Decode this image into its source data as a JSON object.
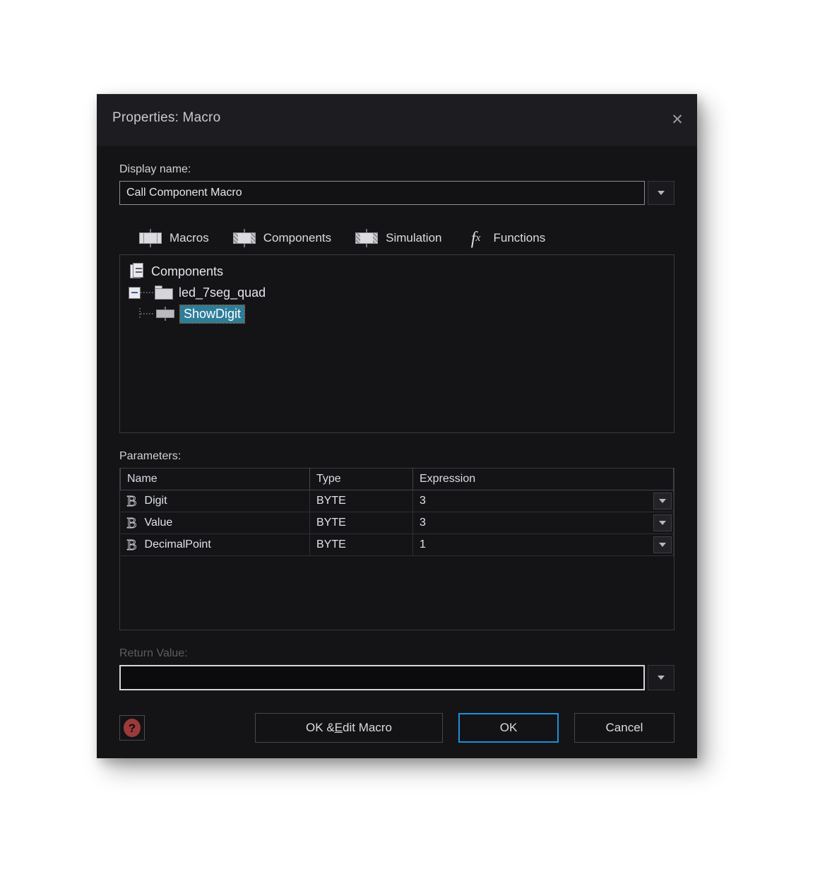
{
  "dialog": {
    "title": "Properties: Macro",
    "close_icon": "close-icon",
    "display_name": {
      "label": "Display name:",
      "value": "Call Component Macro",
      "placeholder": ""
    },
    "tabs": [
      {
        "label": "Macros",
        "icon": "macro-plain-icon"
      },
      {
        "label": "Components",
        "icon": "macro-hatched-icon"
      },
      {
        "label": "Simulation",
        "icon": "macro-hatched-icon"
      },
      {
        "label": "Functions",
        "icon": "fx-icon"
      }
    ],
    "tree": {
      "root": {
        "label": "Components",
        "icon": "documents-icon"
      },
      "folder": {
        "label": "led_7seg_quad",
        "icon": "folder-icon",
        "expander": "minus-box-icon"
      },
      "child": {
        "label": "ShowDigit",
        "icon": "macro-small-icon",
        "selected": true
      }
    },
    "parameters": {
      "label": "Parameters:",
      "columns": [
        "Name",
        "Type",
        "Expression"
      ],
      "rows": [
        {
          "icon": "byte-type-icon",
          "name": "Digit",
          "type": "BYTE",
          "expression": "3"
        },
        {
          "icon": "byte-type-icon",
          "name": "Value",
          "type": "BYTE",
          "expression": "3"
        },
        {
          "icon": "byte-type-icon",
          "name": "DecimalPoint",
          "type": "BYTE",
          "expression": "1"
        }
      ]
    },
    "return_value": {
      "label": "Return Value:",
      "value": "",
      "placeholder": "",
      "disabled": true
    },
    "footer": {
      "help_label": "?",
      "ok_edit_macro": {
        "pre": "OK & ",
        "accel": "E",
        "post": "dit Macro"
      },
      "ok_label": "OK",
      "cancel_label": "Cancel"
    }
  },
  "colors": {
    "dialog_bg": "#141417",
    "titlebar_bg": "#1d1d21",
    "selection": "#2d7d9a",
    "focus_blue": "#1e8fd5",
    "help_red": "#9c3a3a",
    "page_bg": "#ffffff"
  }
}
